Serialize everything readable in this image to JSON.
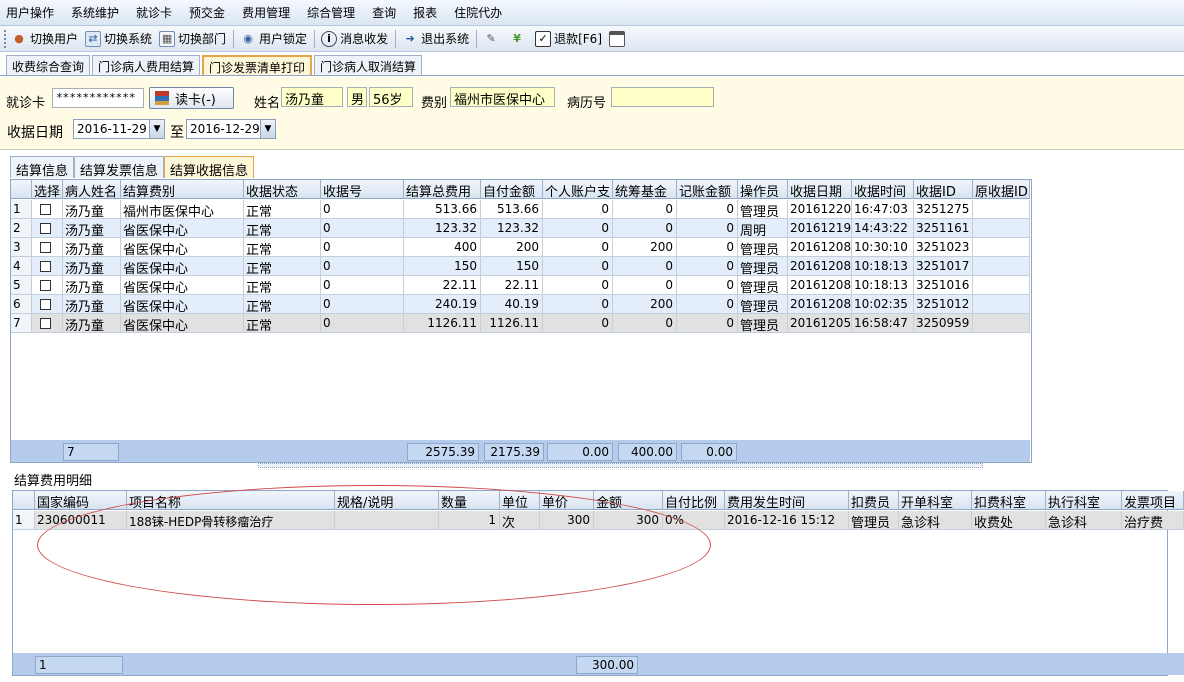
{
  "menu": [
    "用户操作",
    "系统维护",
    "就诊卡",
    "预交金",
    "费用管理",
    "综合管理",
    "查询",
    "报表",
    "住院代办"
  ],
  "toolbar": {
    "items": [
      {
        "label": "切换用户",
        "icon": "users-icon"
      },
      {
        "label": "切换系统",
        "icon": "switch-system-icon"
      },
      {
        "label": "切换部门",
        "icon": "department-icon"
      },
      {
        "label": "用户锁定",
        "icon": "lock-user-icon"
      },
      {
        "label": "消息收发",
        "icon": "info-icon"
      },
      {
        "label": "退出系统",
        "icon": "exit-icon"
      },
      {
        "label": "退款[F6]",
        "icon": "checkbox-icon"
      }
    ]
  },
  "page_tabs": [
    "收费综合查询",
    "门诊病人费用结算",
    "门诊发票清单打印",
    "门诊病人取消结算"
  ],
  "filter": {
    "card_label": "就诊卡",
    "card_value": "************",
    "read_card": "读卡(-)",
    "name_label": "姓名",
    "name": "汤乃童",
    "sex": "男",
    "age": "56岁",
    "fee_type_label": "费别",
    "fee_type": "福州市医保中心",
    "record_label": "病历号",
    "record_value": "",
    "date_label": "收据日期",
    "date_from": "2016-11-29",
    "to": "至",
    "date_to": "2016-12-29"
  },
  "result_tabs": [
    "结算信息",
    "结算发票信息",
    "结算收据信息"
  ],
  "receipts": {
    "columns": [
      "选择",
      "病人姓名",
      "结算费别",
      "收据状态",
      "收据号",
      "结算总费用",
      "自付金额",
      "个人账户支",
      "统筹基金",
      "记账金额",
      "操作员",
      "收据日期",
      "收据时间",
      "收据ID",
      "原收据ID"
    ],
    "rows": [
      [
        "1",
        "汤乃童",
        "福州市医保中心",
        "正常",
        "0",
        "513.66",
        "513.66",
        "0",
        "0",
        "0",
        "管理员",
        "20161220",
        "16:47:03",
        "3251275",
        ""
      ],
      [
        "2",
        "汤乃童",
        "省医保中心",
        "正常",
        "0",
        "123.32",
        "123.32",
        "0",
        "0",
        "0",
        "周明",
        "20161219",
        "14:43:22",
        "3251161",
        ""
      ],
      [
        "3",
        "汤乃童",
        "省医保中心",
        "正常",
        "0",
        "400",
        "200",
        "0",
        "200",
        "0",
        "管理员",
        "20161208",
        "10:30:10",
        "3251023",
        ""
      ],
      [
        "4",
        "汤乃童",
        "省医保中心",
        "正常",
        "0",
        "150",
        "150",
        "0",
        "0",
        "0",
        "管理员",
        "20161208",
        "10:18:13",
        "3251017",
        ""
      ],
      [
        "5",
        "汤乃童",
        "省医保中心",
        "正常",
        "0",
        "22.11",
        "22.11",
        "0",
        "0",
        "0",
        "管理员",
        "20161208",
        "10:18:13",
        "3251016",
        ""
      ],
      [
        "6",
        "汤乃童",
        "省医保中心",
        "正常",
        "0",
        "240.19",
        "40.19",
        "0",
        "200",
        "0",
        "管理员",
        "20161208",
        "10:02:35",
        "3251012",
        ""
      ],
      [
        "7",
        "汤乃童",
        "省医保中心",
        "正常",
        "0",
        "1126.11",
        "1126.11",
        "0",
        "0",
        "0",
        "管理员",
        "20161205",
        "16:58:47",
        "3250959",
        ""
      ]
    ],
    "footer": {
      "count": "7",
      "total": "2575.39",
      "self_pay": "2175.39",
      "personal": "0.00",
      "fund": "400.00",
      "charged": "0.00"
    }
  },
  "detail": {
    "label": "结算费用明细",
    "columns": [
      "国家编码",
      "项目名称",
      "规格/说明",
      "数量",
      "单位",
      "单价",
      "金额",
      "自付比例",
      "费用发生时间",
      "扣费员",
      "开单科室",
      "扣费科室",
      "执行科室",
      "发票项目"
    ],
    "rows": [
      [
        "1",
        "230600011",
        "188铼-HEDP骨转移瘤治疗",
        "",
        "1",
        "次",
        "300",
        "300",
        "0%",
        "2016-12-16 15:12",
        "管理员",
        "急诊科",
        "收费处",
        "急诊科",
        "治疗费"
      ]
    ],
    "footer": {
      "count": "1",
      "amount": "300.00"
    }
  },
  "colors": {
    "active_tab_border": "#e8a44a",
    "annotation": "#d04a4a",
    "grid_footer": "#b4cbec"
  }
}
